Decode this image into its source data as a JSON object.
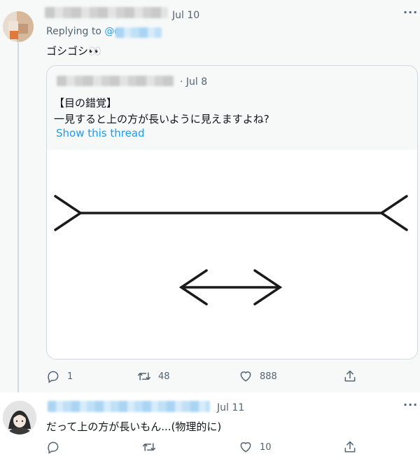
{
  "tweet1": {
    "date": "Jul 10",
    "replying_prefix": "Replying to ",
    "replying_handle": "@c",
    "text": "ゴシゴシ👀",
    "quote": {
      "date": "· Jul 8",
      "line1": "【目の錯覚】",
      "line2": "一見すると上の方が長いように見えますよね?",
      "show_thread": "Show this thread"
    },
    "actions": {
      "replies": "1",
      "retweets": "48",
      "likes": "888"
    }
  },
  "tweet2": {
    "date": "Jul 11",
    "text": "だって上の方が長いもん...(物理的に)",
    "actions": {
      "replies": "",
      "retweets": "",
      "likes": "10"
    }
  },
  "icons": [
    "more-icon",
    "reply-icon",
    "retweet-icon",
    "like-icon",
    "share-icon"
  ],
  "colors": {
    "link": "#1d9bf0",
    "secondary_text": "#536471",
    "border": "#cfd9de"
  }
}
